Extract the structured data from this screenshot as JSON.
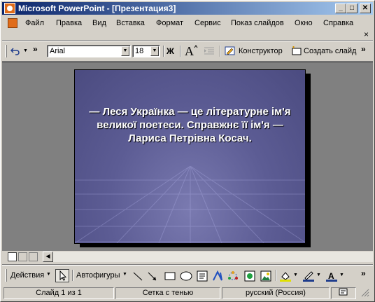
{
  "window": {
    "title": "Microsoft PowerPoint - [Презентация3]",
    "min_label": "_",
    "max_label": "□",
    "close_label": "✕"
  },
  "menu": {
    "items": [
      "Файл",
      "Правка",
      "Вид",
      "Вставка",
      "Формат",
      "Сервис",
      "Показ слайдов",
      "Окно",
      "Справка"
    ],
    "close_doc_label": "×"
  },
  "toolbar": {
    "undo_icon": "undo-icon",
    "overflow_label": "»",
    "font_name": "Arial",
    "font_size": "18",
    "bold_label": "Ж",
    "designer_label": "Конструктор",
    "new_slide_label": "Создать слайд"
  },
  "slide": {
    "text": "— Леся Українка — це літературне ім'я великої поетеси. Справжнє її ім'я — Лариса Петрівна Косач."
  },
  "drawing_toolbar": {
    "actions_label": "Действия",
    "autoshapes_label": "Автофигуры"
  },
  "status": {
    "slide_info": "Слайд 1 из 1",
    "design": "Сетка с тенью",
    "language": "русский (Россия)"
  },
  "colors": {
    "titlebar_start": "#0a246a",
    "titlebar_end": "#a6caf0",
    "slide_bg": "#5c5c94",
    "workspace_bg": "#808080"
  }
}
